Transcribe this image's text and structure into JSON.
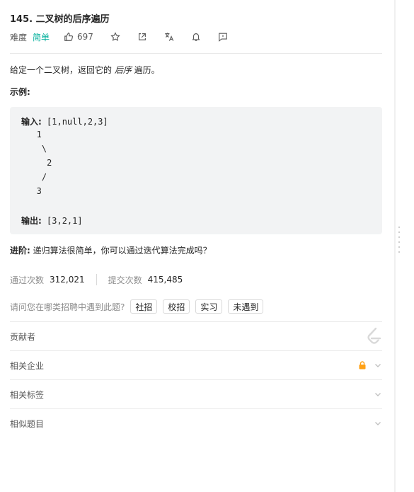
{
  "problem": {
    "title": "145. 二叉树的后序遍历",
    "difficulty_label": "难度",
    "difficulty": "简单",
    "likes": "697"
  },
  "description": {
    "prefix": "给定一个二叉树，返回它的 ",
    "emphasis": "后序",
    "suffix": " 遍历。"
  },
  "example": {
    "title": "示例:",
    "input_label": "输入:",
    "input_value": " [1,null,2,3]",
    "tree_lines": [
      "   1",
      "    \\",
      "     2",
      "    /",
      "   3"
    ],
    "output_label": "输出:",
    "output_value": " [3,2,1]"
  },
  "advanced": {
    "label": "进阶:",
    "text": " 递归算法很简单，你可以通过迭代算法完成吗？"
  },
  "stats": {
    "accepted_label": "通过次数",
    "accepted": "312,021",
    "submissions_label": "提交次数",
    "submissions": "415,485"
  },
  "interview": {
    "question": "请问您在哪类招聘中遇到此题?",
    "options": [
      "社招",
      "校招",
      "实习",
      "未遇到"
    ]
  },
  "sections": {
    "contributors": "贡献者",
    "companies": "相关企业",
    "tags": "相关标签",
    "similar": "相似题目"
  },
  "colors": {
    "easy": "#00af9b",
    "lock": "#ffa116",
    "code_bg": "#f2f3f4"
  }
}
